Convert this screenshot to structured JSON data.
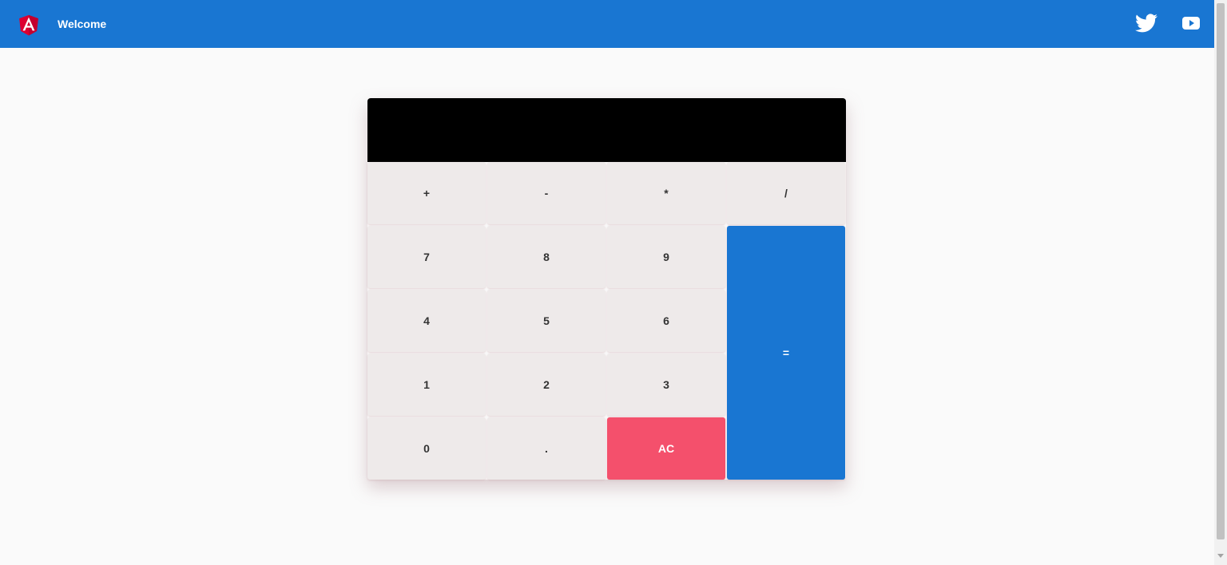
{
  "toolbar": {
    "title": "Welcome",
    "icons": [
      "angular-logo-icon",
      "twitter-icon",
      "youtube-icon"
    ],
    "color": "#1976d2"
  },
  "calculator": {
    "display_value": "",
    "keys": {
      "plus": "+",
      "minus": "-",
      "multiply": "*",
      "divide": "/",
      "seven": "7",
      "eight": "8",
      "nine": "9",
      "four": "4",
      "five": "5",
      "six": "6",
      "one": "1",
      "two": "2",
      "three": "3",
      "zero": "0",
      "decimal": ".",
      "clear": "AC",
      "equals": "="
    },
    "colors": {
      "display": "#000000",
      "key": "#eeeaea",
      "equals": "#1976d2",
      "clear": "#f4506c"
    }
  }
}
